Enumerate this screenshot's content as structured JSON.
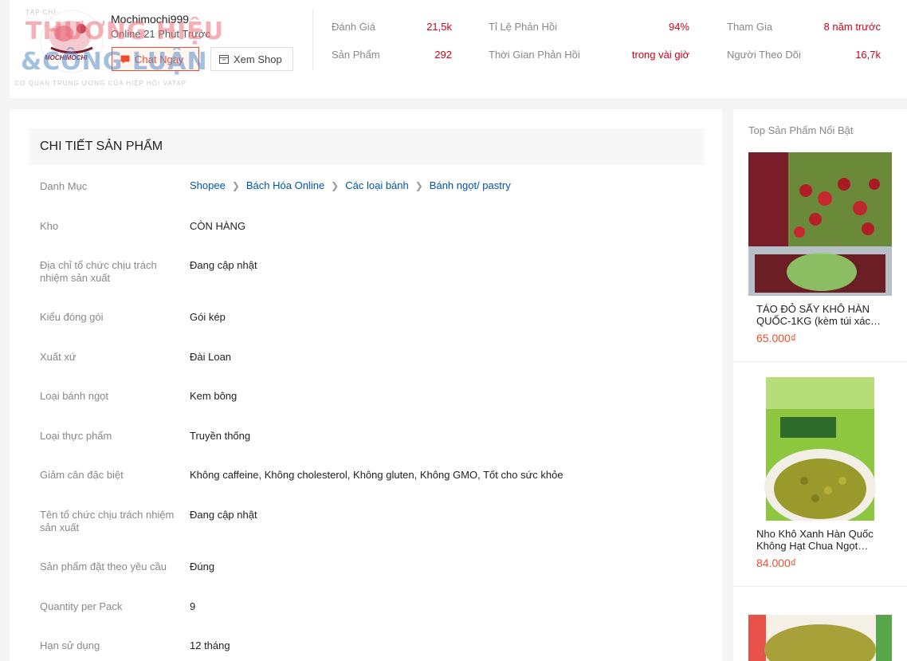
{
  "shop": {
    "name": "Mochimochi999",
    "online": "Online 21 Phút Trước",
    "chat_button": "Chat Ngay",
    "view_shop_button": "Xem Shop",
    "logo_text": "MOCHIMOCHI"
  },
  "stats": [
    {
      "label": "Đánh Giá",
      "value": "21,5k"
    },
    {
      "label": "Sản Phẩm",
      "value": "292"
    },
    {
      "label": "Tỉ Lệ Phản Hồi",
      "value": "94%"
    },
    {
      "label": "Thời Gian Phản Hồi",
      "value": "trong vài giờ"
    },
    {
      "label": "Tham Gia",
      "value": "8 năm trước"
    },
    {
      "label": "Người Theo Dõi",
      "value": "16,7k"
    }
  ],
  "watermark": {
    "top": "TẠP CHÍ",
    "line1": "THƯƠNG HIỆU",
    "line2": "&CÔNG LUẬN",
    "bottom": "CƠ QUAN TRUNG ƯƠNG CỦA HIỆP HỘI VATAP"
  },
  "details": {
    "title": "CHI TIẾT SẢN PHẨM",
    "category_label": "Danh Mục",
    "breadcrumb": [
      "Shopee",
      "Bách Hóa Online",
      "Các loại bánh",
      "Bánh ngọt/ pastry"
    ],
    "rows": [
      {
        "label": "Kho",
        "value": "CÒN HÀNG"
      },
      {
        "label": "Địa chỉ tổ chức chịu trách nhiệm sản xuất",
        "value": "Đang cập nhật"
      },
      {
        "label": "Kiểu đóng gói",
        "value": "Gói kép"
      },
      {
        "label": "Xuất xứ",
        "value": "Đài Loan"
      },
      {
        "label": "Loại bánh ngọt",
        "value": "Kem bông"
      },
      {
        "label": "Loại thực phẩm",
        "value": "Truyền thống"
      },
      {
        "label": "Giảm cân đặc biệt",
        "value": "Không caffeine, Không cholesterol, Không gluten, Không GMO, Tốt cho sức khỏe"
      },
      {
        "label": "Tên tổ chức chịu trách nhiệm sản xuất",
        "value": "Đang cập nhật"
      },
      {
        "label": "Sản phẩm đặt theo yêu cầu",
        "value": "Đúng"
      },
      {
        "label": "Quantity per Pack",
        "value": "9"
      },
      {
        "label": "Hạn sử dụng",
        "value": "12 tháng"
      }
    ]
  },
  "sidebar": {
    "title": "Top Sản Phẩm Nổi Bật",
    "products": [
      {
        "name": "TÁO ĐỎ SẤY KHÔ HÀN QUỐC-1KG (kèm túi xác…",
        "price": "65.000₫"
      },
      {
        "name": "Nho Khô Xanh Hàn Quốc Không Hạt Chua Ngọt…",
        "price": "84.000₫"
      }
    ]
  },
  "colors": {
    "accent": "#ee4d2d",
    "stat_value": "#d0011b",
    "link": "#0055aa"
  }
}
